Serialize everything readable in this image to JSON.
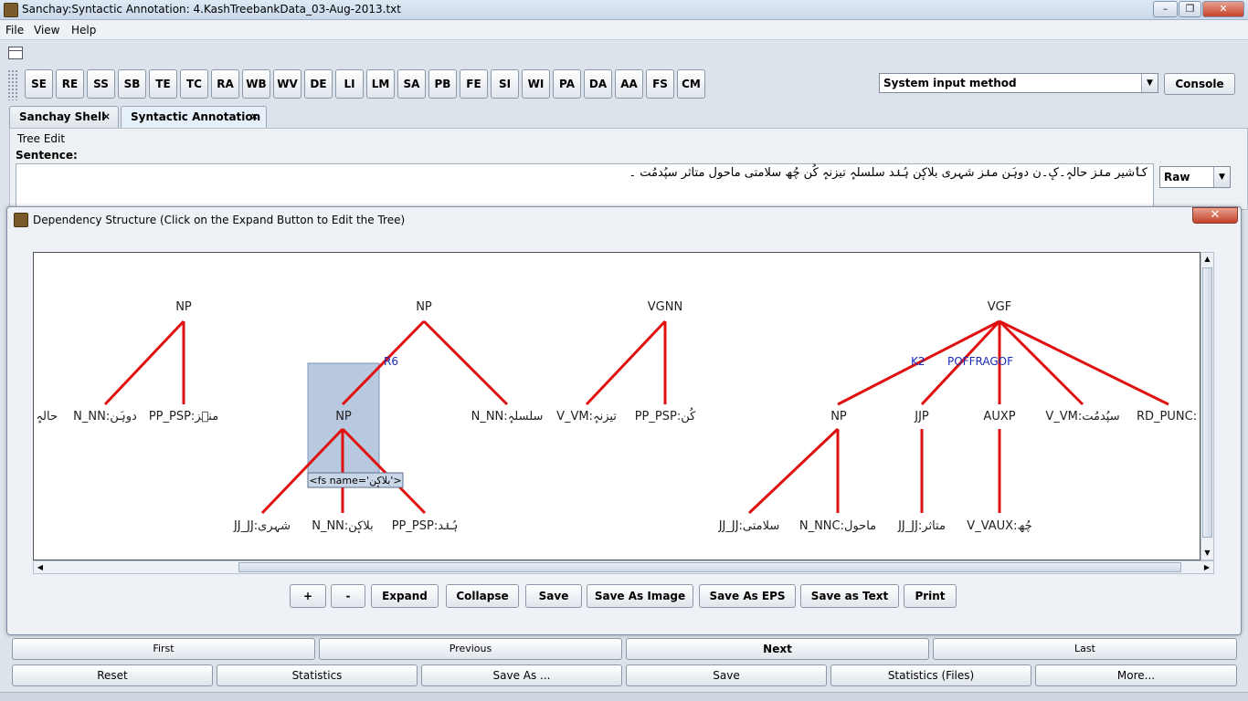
{
  "window": {
    "title": "Sanchay:Syntactic Annotation: 4.KashTreebankData_03-Aug-2013.txt"
  },
  "menu": [
    "File",
    "View",
    "Help"
  ],
  "toolbar": {
    "modules": [
      "SE",
      "RE",
      "SS",
      "SB",
      "TE",
      "TC",
      "RA",
      "WB",
      "WV",
      "DE",
      "LI",
      "LM",
      "SA",
      "PB",
      "FE",
      "SI",
      "WI",
      "PA",
      "DA",
      "AA",
      "FS",
      "CM"
    ],
    "input_method": "System input method",
    "console_label": "Console"
  },
  "tabs": [
    {
      "label": "Sanchay Shell",
      "close": "×"
    },
    {
      "label": "Syntactic Annotation",
      "close": "×"
    }
  ],
  "tree_edit": {
    "title": "Tree Edit",
    "sentence_label": "Sentence:",
    "sentence": "کٲشیر منٛز حالہٕ۔کٕ۔ن دوہَن منٛز شہری بلاکٕن ہُنٛد سلسلہٕ تیزنہٕ کُن چُھ سلامتی ماحول متاثر سپُدمُت ۔",
    "format": "Raw"
  },
  "dialog": {
    "title": "Dependency Structure (Click on the Expand Button to Edit the Tree)",
    "close": "✕",
    "tooltip": "<fs name='بلاکٕن'>",
    "nodes": [
      {
        "id": "np1",
        "label": "NP"
      },
      {
        "id": "np2",
        "label": "NP"
      },
      {
        "id": "vgnn",
        "label": "VGNN"
      },
      {
        "id": "vgf",
        "label": "VGF"
      },
      {
        "id": "w1",
        "label": "حالہٕ"
      },
      {
        "id": "w2",
        "label": "N_NN:دوہَن"
      },
      {
        "id": "w3",
        "label": "PP_PSP:منٛز"
      },
      {
        "id": "np3",
        "label": "NP"
      },
      {
        "id": "w4",
        "label": "N_NN:سلسلہٕ"
      },
      {
        "id": "w5",
        "label": "V_VM:تیزنہٕ"
      },
      {
        "id": "w6",
        "label": "PP_PSP:کُن"
      },
      {
        "id": "np4",
        "label": "NP"
      },
      {
        "id": "jjp",
        "label": "JJP"
      },
      {
        "id": "auxp",
        "label": "AUXP"
      },
      {
        "id": "w7",
        "label": "V_VM:سپُدمُت"
      },
      {
        "id": "w8",
        "label": "RD_PUNC:"
      },
      {
        "id": "w9",
        "label": "JJ_JJ:شہری"
      },
      {
        "id": "w10",
        "label": "N_NN:بلاکٕن"
      },
      {
        "id": "w11",
        "label": "PP_PSP:ہُنٛد"
      },
      {
        "id": "w12",
        "label": "JJ_JJ:سلامتی"
      },
      {
        "id": "w13",
        "label": "N_NNC:ماحول"
      },
      {
        "id": "w14",
        "label": "JJ_JJ:متاثر"
      },
      {
        "id": "w15",
        "label": "V_VAUX:چُھ"
      }
    ],
    "relations": [
      {
        "id": "r6",
        "label": "R6"
      },
      {
        "id": "k2",
        "label": "K2"
      },
      {
        "id": "pof",
        "label": "POFFRAGOF"
      }
    ],
    "buttons": [
      "+",
      "-",
      "Expand",
      "Collapse",
      "Save",
      "Save As Image",
      "Save As EPS",
      "Save as Text",
      "Print"
    ]
  },
  "nav": {
    "row1": [
      "First",
      "Previous",
      "Next",
      "Last"
    ],
    "row2": [
      "Reset",
      "Statistics",
      "Save As ...",
      "Save",
      "Statistics (Files)",
      "More..."
    ]
  },
  "colors": {
    "edge": "#e01010",
    "relation": "#1a2bb5",
    "selection": "#b8c8de"
  }
}
